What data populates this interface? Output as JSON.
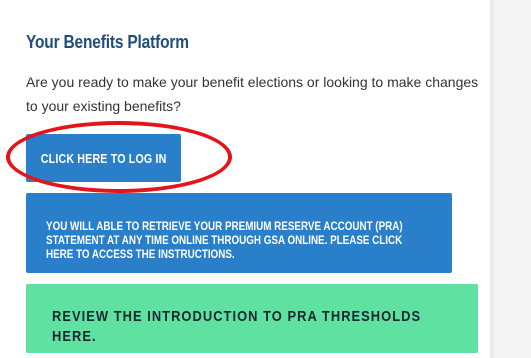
{
  "section": {
    "title": "Your Benefits Platform",
    "intro": "Are you ready to make your benefit elections or looking to make changes to your existing benefits?"
  },
  "buttons": {
    "login_label": "CLICK HERE TO LOG IN",
    "pra_label": "YOU WILL ABLE TO RETRIEVE YOUR PREMIUM RESERVE ACCOUNT (PRA) STATEMENT AT ANY TIME ONLINE THROUGH GSA ONLINE. PLEASE CLICK HERE TO ACCESS THE INSTRUCTIONS.",
    "review_label": "REVIEW THE INTRODUCTION TO PRA THRESHOLDS HERE."
  },
  "colors": {
    "heading": "#1f4e7d",
    "primary_button": "#2a7fcb",
    "secondary_button": "#5fe2a1",
    "highlight_ring": "#e3151b"
  }
}
